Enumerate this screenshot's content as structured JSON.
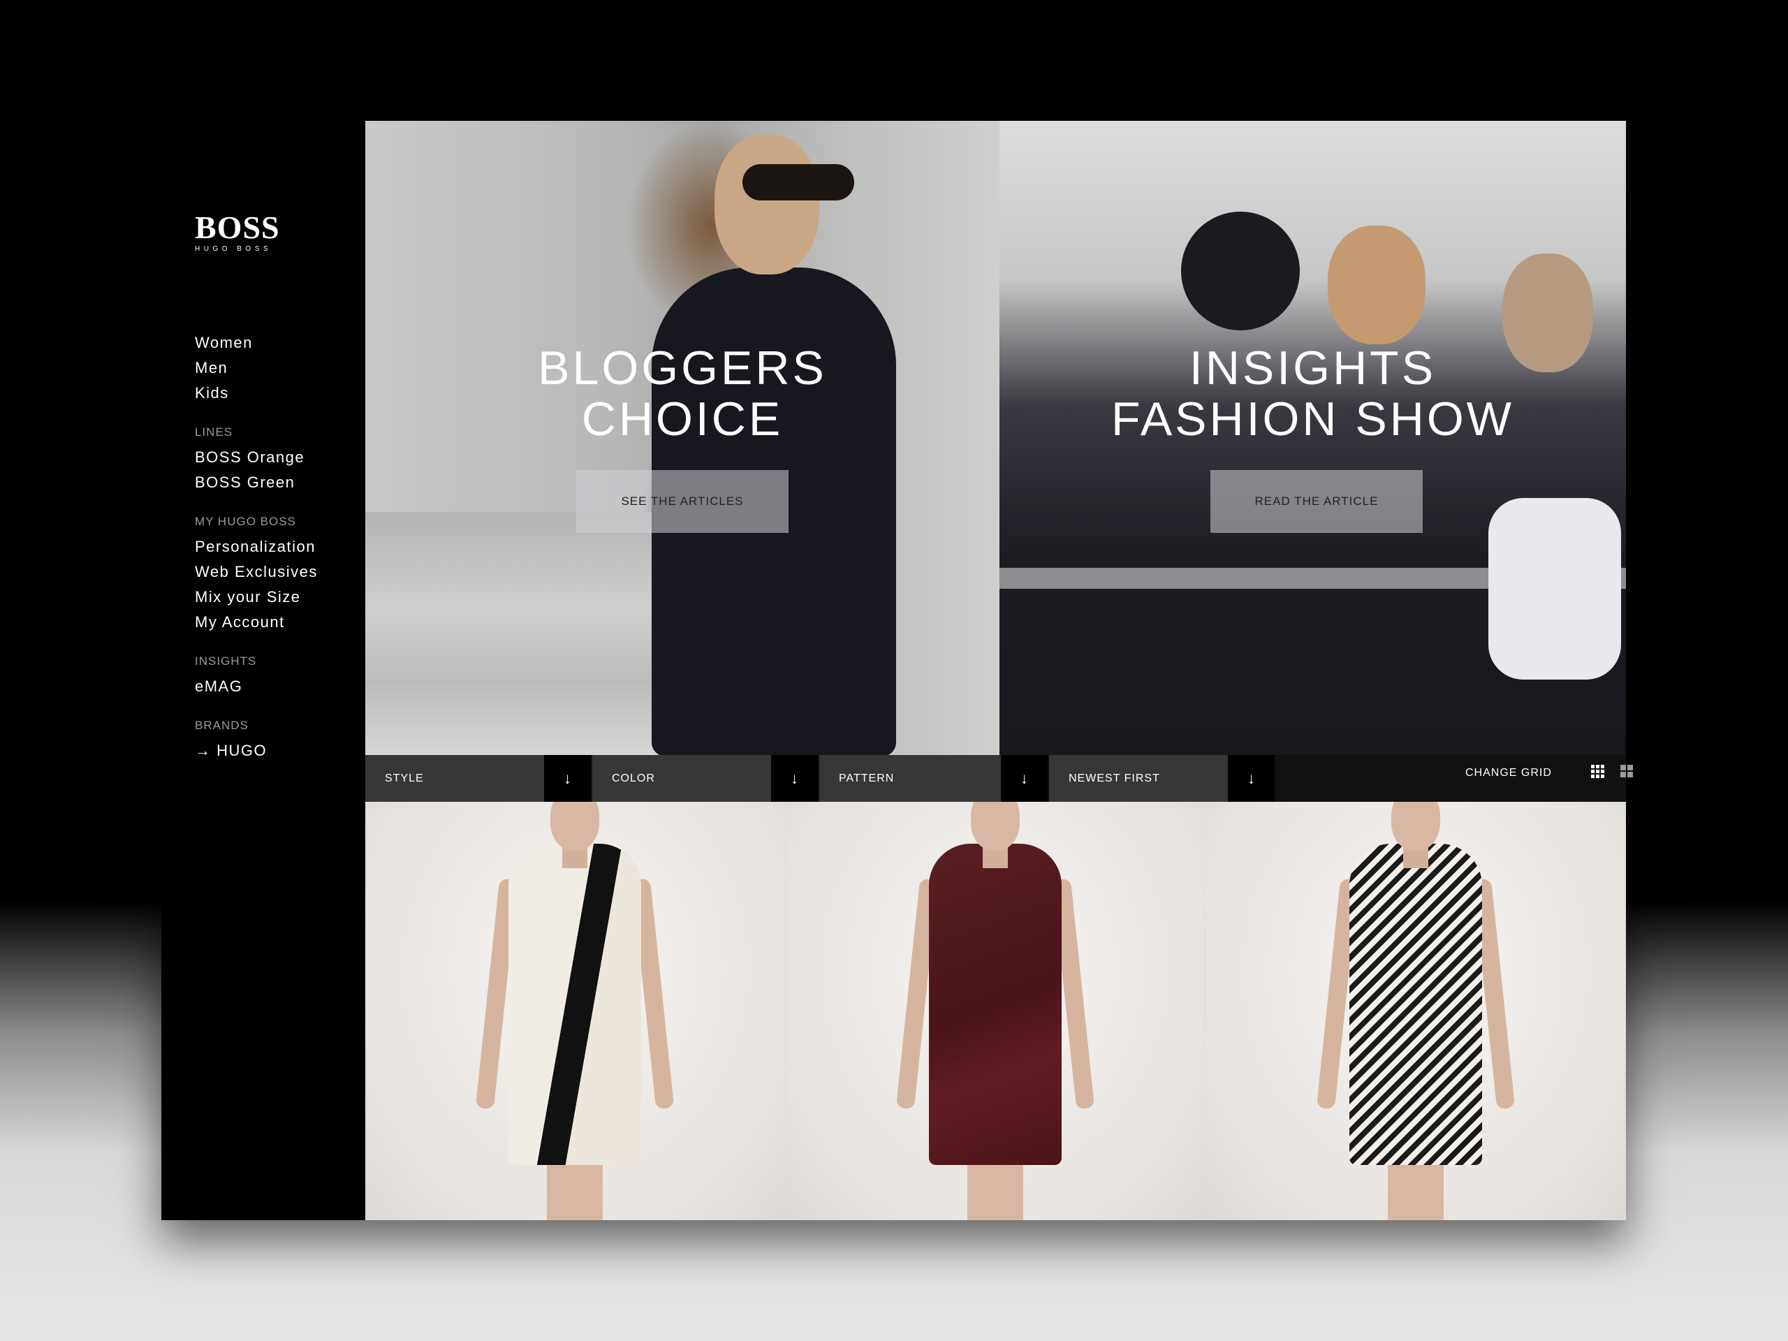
{
  "brand": {
    "logo": "BOSS",
    "logo_sub": "HUGO BOSS"
  },
  "nav": {
    "main": [
      "Women",
      "Men",
      "Kids"
    ],
    "lines": {
      "heading": "LINES",
      "items": [
        "BOSS Orange",
        "BOSS Green"
      ]
    },
    "my_hugo_boss": {
      "heading": "MY HUGO BOSS",
      "items": [
        "Personalization",
        "Web Exclusives",
        "Mix your Size",
        "My Account"
      ]
    },
    "insights": {
      "heading": "INSIGHTS",
      "items": [
        "eMAG"
      ]
    },
    "brands": {
      "heading": "BRANDS",
      "items": [
        "→ HUGO"
      ]
    }
  },
  "hero": {
    "left": {
      "title_line1": "BLOGGERS",
      "title_line2": "CHOICE",
      "button": "SEE THE ARTICLES"
    },
    "right": {
      "title_line1": "INSIGHTS",
      "title_line2": "FASHION SHOW",
      "button": "READ THE ARTICLE"
    }
  },
  "filters": {
    "style": "STYLE",
    "color": "COLOR",
    "pattern": "PATTERN",
    "sort": "NEWEST FIRST",
    "arrow": "↓",
    "change_grid": "CHANGE GRID"
  },
  "products": [
    {
      "name": "cream-black-dress"
    },
    {
      "name": "burgundy-dress"
    },
    {
      "name": "striped-dress"
    }
  ],
  "colors": {
    "sidebar": "#000000",
    "filterbar": "#373737",
    "filter_arrow_bg": "#000000"
  }
}
